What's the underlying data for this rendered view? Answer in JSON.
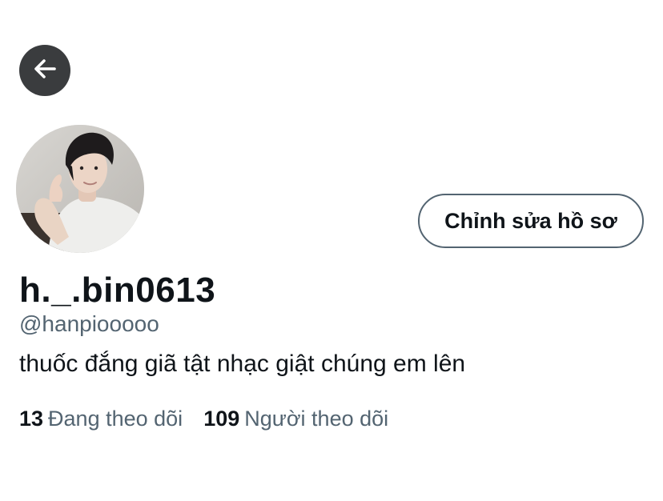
{
  "header": {
    "back_icon": "arrow-left-icon"
  },
  "profile": {
    "avatar_alt": "profile photo",
    "edit_button_label": "Chỉnh sửa hồ sơ",
    "display_name": "h._.bin0613",
    "handle": "@hanpiooooo",
    "bio": "thuốc đắng giã tật nhạc giật chúng em lên"
  },
  "stats": {
    "following_count": "13",
    "following_label": "Đang theo dõi",
    "followers_count": "109",
    "followers_label": "Người theo dõi"
  },
  "colors": {
    "primary_text": "#0f1419",
    "secondary_text": "#536471",
    "back_button_bg": "#3a3c3e",
    "button_border": "#536471"
  }
}
